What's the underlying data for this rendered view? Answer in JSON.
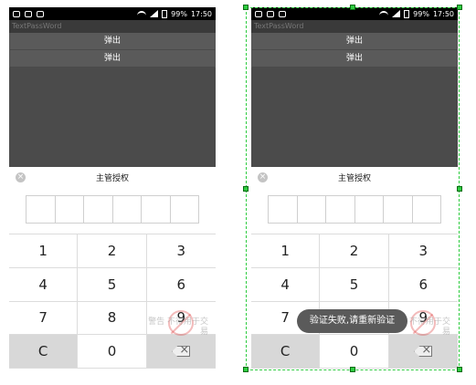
{
  "screens": [
    {
      "status": {
        "battery": "99%",
        "time": "17:50"
      },
      "title": "TextPassWord",
      "popup_buttons": [
        "弹出",
        "弹出"
      ],
      "dialog": {
        "title": "主管授权"
      },
      "keypad": [
        "1",
        "2",
        "3",
        "4",
        "5",
        "6",
        "7",
        "8",
        "9",
        "C",
        "0"
      ],
      "watermark": "警告 不得用于交易"
    },
    {
      "status": {
        "battery": "99%",
        "time": "17:50"
      },
      "title": "TextPassWord",
      "popup_buttons": [
        "弹出",
        "弹出"
      ],
      "dialog": {
        "title": "主管授权"
      },
      "keypad": [
        "1",
        "2",
        "3",
        "4",
        "5",
        "6",
        "7",
        "8",
        "9",
        "C",
        "0"
      ],
      "watermark": "警告 不得用于交易",
      "toast": "验证失败,请重新验证"
    }
  ],
  "colors": {
    "selection": "#2ecc40",
    "dim": "#4b4b4b",
    "toast": "#5a5a5a"
  },
  "icons": [
    "close-icon",
    "backspace-icon",
    "wifi-icon",
    "battery-icon"
  ]
}
